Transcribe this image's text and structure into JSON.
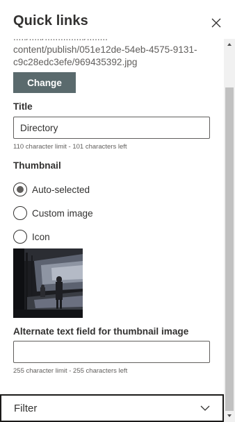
{
  "header": {
    "title": "Quick links",
    "close_icon": "close-icon"
  },
  "image_url": {
    "line0": "...../...../.............../........",
    "line1": "content/publish/051e12de-54eb-4575-9131-",
    "line2": "c9c28edc3efe/969435392.jpg"
  },
  "change_button": {
    "label": "Change"
  },
  "title_field": {
    "label": "Title",
    "value": "Directory",
    "hint": "110 character limit - 101 characters left"
  },
  "thumbnail": {
    "label": "Thumbnail",
    "options": [
      {
        "label": "Auto-selected",
        "checked": true
      },
      {
        "label": "Custom image",
        "checked": false
      },
      {
        "label": "Icon",
        "checked": false
      }
    ]
  },
  "alt_text_field": {
    "label": "Alternate text field for thumbnail image",
    "value": "",
    "hint": "255 character limit - 255 characters left"
  },
  "filter": {
    "label": "Filter",
    "icon": "chevron-down-icon"
  },
  "colors": {
    "accent_button": "#5a6a6d",
    "text": "#323130",
    "muted": "#605e5c"
  }
}
